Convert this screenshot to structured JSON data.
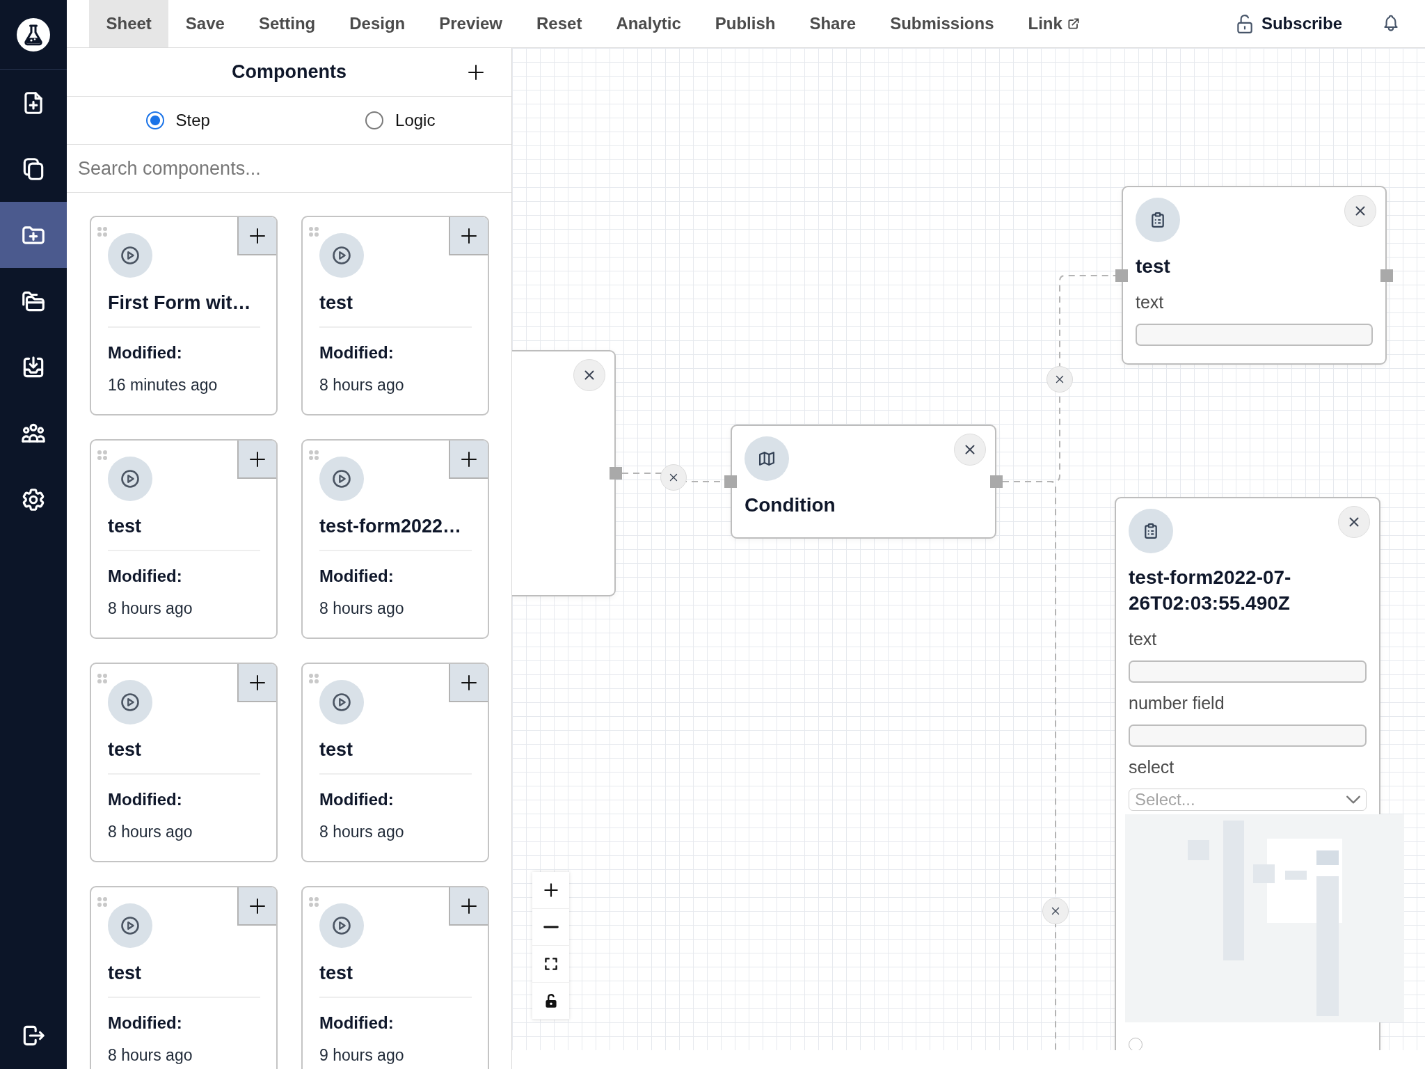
{
  "sidebar": {
    "items": [
      {
        "kind": "newfile",
        "selected": false
      },
      {
        "kind": "duplicate",
        "selected": false
      },
      {
        "kind": "newfolder",
        "selected": true
      },
      {
        "kind": "folders",
        "selected": false
      },
      {
        "kind": "inbox",
        "selected": false
      },
      {
        "kind": "users",
        "selected": false
      },
      {
        "kind": "gear",
        "selected": false
      }
    ],
    "footer": {
      "kind": "logout"
    }
  },
  "menu": {
    "items": [
      {
        "label": "Sheet",
        "selected": true,
        "external": false
      },
      {
        "label": "Save",
        "selected": false,
        "external": false
      },
      {
        "label": "Setting",
        "selected": false,
        "external": false
      },
      {
        "label": "Design",
        "selected": false,
        "external": false
      },
      {
        "label": "Preview",
        "selected": false,
        "external": false
      },
      {
        "label": "Reset",
        "selected": false,
        "external": false
      },
      {
        "label": "Analytic",
        "selected": false,
        "external": false
      },
      {
        "label": "Publish",
        "selected": false,
        "external": false
      },
      {
        "label": "Share",
        "selected": false,
        "external": false
      },
      {
        "label": "Submissions",
        "selected": false,
        "external": false
      },
      {
        "label": "Link",
        "selected": false,
        "external": true
      }
    ],
    "subscribe": {
      "label": "Subscribe"
    }
  },
  "components_panel": {
    "title": "Components",
    "modes": [
      {
        "label": "Step",
        "selected": true
      },
      {
        "label": "Logic",
        "selected": false
      }
    ],
    "search": {
      "placeholder": "Search components..."
    },
    "cards": [
      {
        "title": "First Form wit…",
        "modified_label": "Modified:",
        "modified": "16 minutes ago"
      },
      {
        "title": "test",
        "modified_label": "Modified:",
        "modified": "8 hours ago"
      },
      {
        "title": "test",
        "modified_label": "Modified:",
        "modified": "8 hours ago"
      },
      {
        "title": "test-form2022…",
        "modified_label": "Modified:",
        "modified": "8 hours ago"
      },
      {
        "title": "test",
        "modified_label": "Modified:",
        "modified": "8 hours ago"
      },
      {
        "title": "test",
        "modified_label": "Modified:",
        "modified": "8 hours ago"
      },
      {
        "title": "test",
        "modified_label": "Modified:",
        "modified": "8 hours ago"
      },
      {
        "title": "test",
        "modified_label": "Modified:",
        "modified": "9 hours ago"
      }
    ]
  },
  "canvas": {
    "nodes": [
      {
        "kind": "step"
      },
      {
        "kind": "condition",
        "title": "Condition"
      },
      {
        "kind": "form",
        "title": "test",
        "fields": [
          {
            "kind": "input",
            "label": "text"
          }
        ]
      },
      {
        "kind": "form",
        "title": "test-form2022-07-26T02:03:55.490Z",
        "fields": [
          {
            "kind": "input",
            "label": "text"
          },
          {
            "kind": "input",
            "label": "number field"
          },
          {
            "kind": "select",
            "label": "select",
            "placeholder": "Select..."
          },
          {
            "kind": "radio",
            "checked": false
          }
        ]
      }
    ]
  }
}
